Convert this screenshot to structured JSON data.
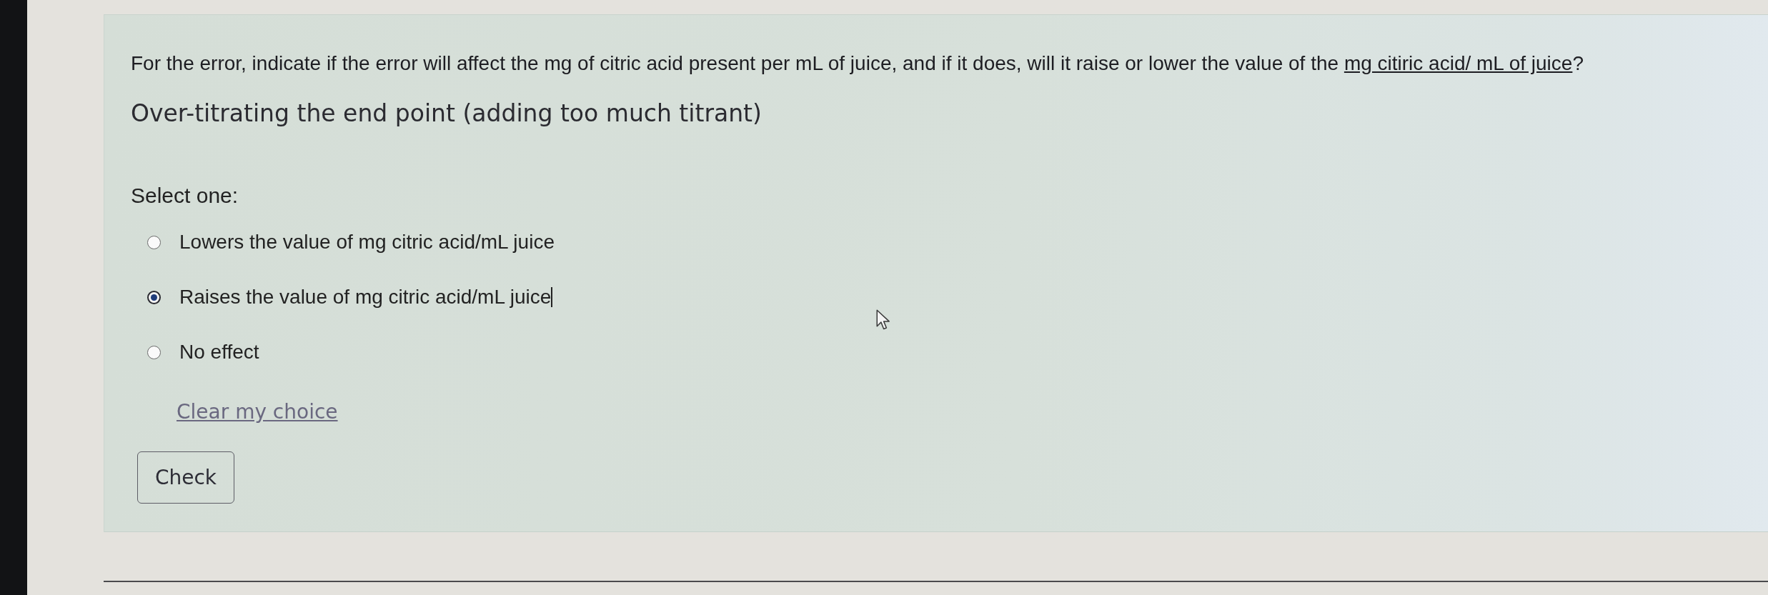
{
  "question": {
    "prompt": "For the error, indicate if the error will affect the mg of citric acid present per mL of juice, and if it does, will it raise or lower the value of the ",
    "prompt_link": "mg citiric acid/ mL of juice",
    "prompt_end": "?",
    "scenario": "Over-titrating the end point (adding too much titrant)"
  },
  "answer": {
    "instruction": "Select one:",
    "options": [
      {
        "label": "Lowers the value of mg citric acid/mL juice",
        "selected": false,
        "focused": false
      },
      {
        "label": "Raises the value of mg citric acid/mL juice",
        "selected": true,
        "focused": true
      },
      {
        "label": "No effect",
        "selected": false,
        "focused": false
      }
    ],
    "clear_link": "Clear my choice"
  },
  "buttons": [
    "Check"
  ]
}
